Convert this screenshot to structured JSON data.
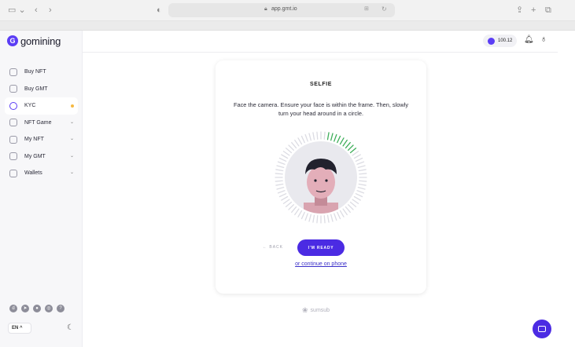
{
  "browser": {
    "url": "app.gmt.io",
    "sidebar_toggle_icon": "sidebar-icon",
    "nav_back_glyph": "‹",
    "nav_forward_glyph": "›"
  },
  "brand": {
    "logo_text": "gomining",
    "accent": "#4b2be3"
  },
  "sidebar": {
    "items": [
      {
        "label": "Buy NFT",
        "icon": "bag-icon",
        "has_chevron": false
      },
      {
        "label": "Buy GMT",
        "icon": "card-icon",
        "has_chevron": false
      },
      {
        "label": "KYC",
        "icon": "shield-check-icon",
        "active": true,
        "badge_color": "#f5b942"
      },
      {
        "label": "NFT Game",
        "icon": "gamepad-icon",
        "has_chevron": true
      },
      {
        "label": "My NFT",
        "icon": "nft-icon",
        "has_chevron": true
      },
      {
        "label": "My GMT",
        "icon": "coin-icon",
        "has_chevron": true
      },
      {
        "label": "Wallets",
        "icon": "wallet-icon",
        "has_chevron": true
      }
    ],
    "socials": [
      "discord-icon",
      "telegram-icon",
      "medium-icon",
      "instagram-icon",
      "help-icon"
    ],
    "language": "EN ^"
  },
  "topbar": {
    "balance": "100.12"
  },
  "kyc": {
    "title": "SELFIE",
    "instruction": "Face the camera. Ensure your face is within the frame. Then, slowly turn your head around in a circle.",
    "progress_fraction": 0.12,
    "back_label": "← BACK",
    "ready_label": "I'M READY",
    "phone_link": "or continue on phone",
    "provider": "sumsub"
  }
}
